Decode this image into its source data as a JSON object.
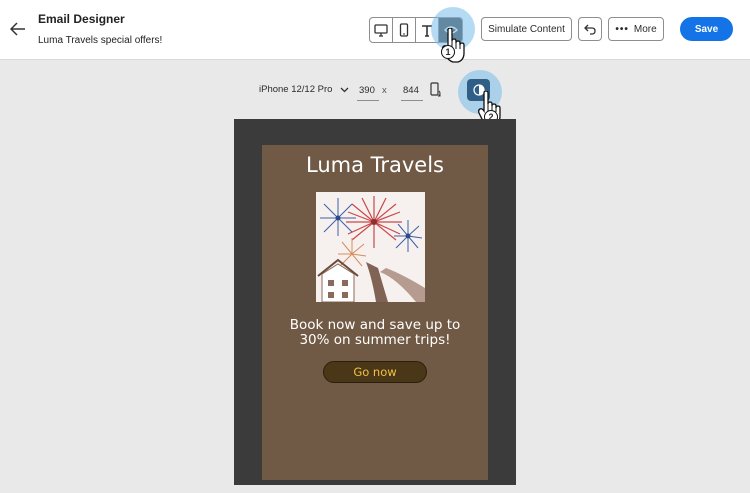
{
  "app": {
    "title": "Email Designer",
    "subtitle": "Luma Travels special offers!"
  },
  "header": {
    "back_icon": "arrow-left-icon",
    "view_buttons": [
      "desktop-icon",
      "mobile-icon",
      "text-icon",
      "eye-icon"
    ],
    "active_view": "eye-icon",
    "simulate_label": "Simulate Content",
    "undo_icon": "undo-icon",
    "more_label": "More",
    "save_label": "Save",
    "accent_color": "#1473e6"
  },
  "device_bar": {
    "device": "iPhone 12/12 Pro",
    "width": "390",
    "separator": "x",
    "height": "844",
    "dark_mode_icon": "contrast-icon"
  },
  "callouts": {
    "step1": "1",
    "step2": "2"
  },
  "email": {
    "title": "Luma Travels",
    "image_alt": "fireworks",
    "text_line1": "Book now and save up to",
    "text_line2": "30% on summer trips!",
    "cta": "Go now",
    "bg_color": "#715a45",
    "cta_text_color": "#f2c043"
  }
}
